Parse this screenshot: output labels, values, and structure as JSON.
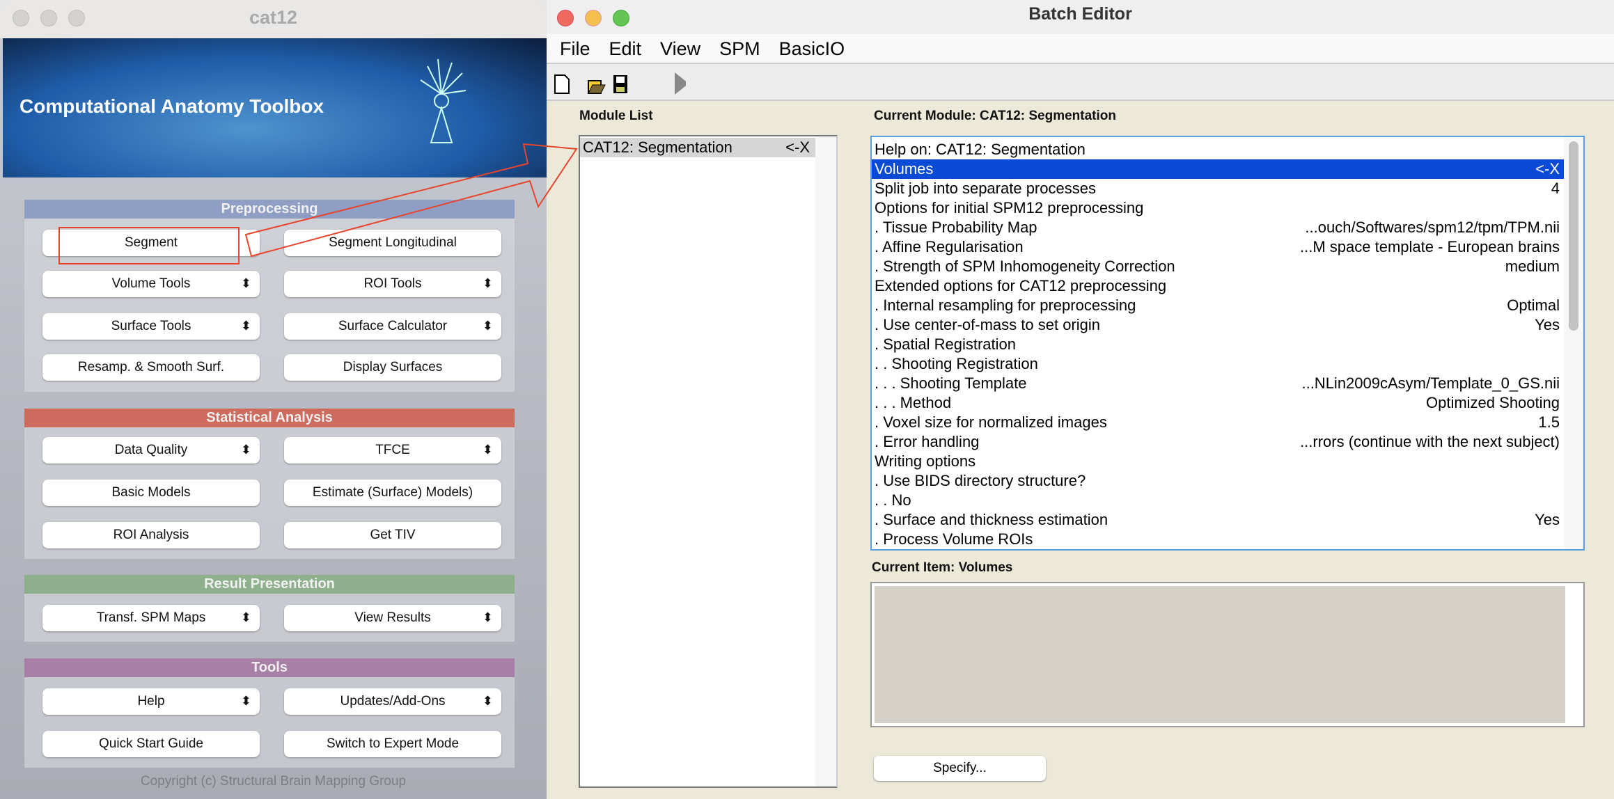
{
  "cat12": {
    "title": "cat12",
    "banner_title": "Computational Anatomy Toolbox",
    "sections": [
      {
        "title": "Preprocessing",
        "color": "#8e9fc3",
        "buttons": [
          {
            "label": "Segment",
            "menu": false
          },
          {
            "label": "Segment Longitudinal",
            "menu": false
          },
          {
            "label": "Volume Tools",
            "menu": true
          },
          {
            "label": "ROI Tools",
            "menu": true
          },
          {
            "label": "Surface Tools",
            "menu": true
          },
          {
            "label": "Surface Calculator",
            "menu": true
          },
          {
            "label": "Resamp. & Smooth Surf.",
            "menu": false
          },
          {
            "label": "Display Surfaces",
            "menu": false
          }
        ]
      },
      {
        "title": "Statistical Analysis",
        "color": "#cd6b5e",
        "buttons": [
          {
            "label": "Data Quality",
            "menu": true
          },
          {
            "label": "TFCE",
            "menu": true
          },
          {
            "label": "Basic Models",
            "menu": false
          },
          {
            "label": "Estimate (Surface) Models)",
            "menu": false
          },
          {
            "label": "ROI Analysis",
            "menu": false
          },
          {
            "label": "Get TIV",
            "menu": false
          }
        ]
      },
      {
        "title": "Result Presentation",
        "color": "#8fb08c",
        "buttons": [
          {
            "label": "Transf. SPM Maps",
            "menu": true
          },
          {
            "label": "View Results",
            "menu": true
          }
        ]
      },
      {
        "title": "Tools",
        "color": "#a87fa6",
        "buttons": [
          {
            "label": "Help",
            "menu": true
          },
          {
            "label": "Updates/Add-Ons",
            "menu": true
          },
          {
            "label": "Quick Start Guide",
            "menu": false
          },
          {
            "label": "Switch to Expert Mode",
            "menu": false
          }
        ]
      }
    ],
    "copyright": "Copyright (c) Structural Brain Mapping Group"
  },
  "batch": {
    "title": "Batch Editor",
    "menu": [
      "File",
      "Edit",
      "View",
      "SPM",
      "BasicIO"
    ],
    "toolbar": [
      "new-file-icon",
      "open-folder-icon",
      "save-icon",
      "run-icon"
    ],
    "module_list_label": "Module List",
    "modules": [
      {
        "name": "CAT12: Segmentation",
        "mark": "<-X"
      }
    ],
    "current_module_label": "Current Module: CAT12: Segmentation",
    "items": [
      [
        "Help on: CAT12: Segmentation",
        ""
      ],
      [
        "Volumes",
        "<-X"
      ],
      [
        "Split job into separate processes",
        "4"
      ],
      [
        "Options for initial SPM12 preprocessing",
        ""
      ],
      [
        ". Tissue Probability Map",
        "...ouch/Softwares/spm12/tpm/TPM.nii"
      ],
      [
        ". Affine Regularisation",
        "...M space template - European brains"
      ],
      [
        ". Strength of SPM Inhomogeneity Correction",
        "medium"
      ],
      [
        "Extended options for CAT12 preprocessing",
        ""
      ],
      [
        ". Internal resampling for preprocessing",
        "Optimal"
      ],
      [
        ". Use center-of-mass to set origin",
        "Yes"
      ],
      [
        ". Spatial Registration",
        ""
      ],
      [
        ". . Shooting Registration",
        ""
      ],
      [
        ". . . Shooting Template",
        "...NLin2009cAsym/Template_0_GS.nii"
      ],
      [
        ". . . Method",
        "Optimized Shooting"
      ],
      [
        ". Voxel size for normalized images",
        "1.5"
      ],
      [
        ". Error handling",
        "...rrors (continue with the next subject)"
      ],
      [
        "Writing options",
        ""
      ],
      [
        ". Use BIDS directory structure?",
        ""
      ],
      [
        ". . No",
        ""
      ],
      [
        ". Surface and thickness estimation",
        "Yes"
      ],
      [
        ". Process Volume ROIs",
        ""
      ]
    ],
    "selected_index": 1,
    "current_item_label": "Current Item: Volumes",
    "specify_label": "Specify..."
  }
}
